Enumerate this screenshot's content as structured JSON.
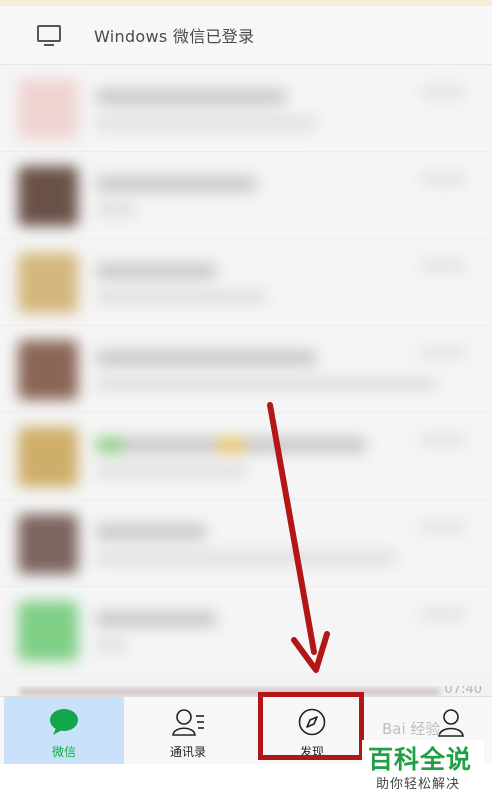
{
  "windows_login": {
    "icon": "monitor-icon",
    "text": "Windows 微信已登录"
  },
  "chat_list": {
    "rows": [
      {
        "avatar_color": "#e9d1cf"
      },
      {
        "avatar_color": "#6a5148"
      },
      {
        "avatar_color": "#d4b77c"
      },
      {
        "avatar_color": "#8b6657"
      },
      {
        "avatar_color": "#cfae6a"
      },
      {
        "avatar_color": "#7c6660"
      },
      {
        "avatar_color": "#7fcf86"
      }
    ],
    "last_visible_time": "07:40"
  },
  "tab_bar": {
    "tabs": [
      {
        "label": "微信",
        "icon": "chat-bubble-icon",
        "active": true
      },
      {
        "label": "通讯录",
        "icon": "contacts-icon",
        "active": false
      },
      {
        "label": "发现",
        "icon": "compass-icon",
        "active": false
      },
      {
        "label": "",
        "icon": "person-icon",
        "active": false
      }
    ],
    "active_color": "#12a74a",
    "active_bg": "#c9e2fa"
  },
  "annotation": {
    "color": "#b21616",
    "target": "发现"
  },
  "watermark": {
    "title": "百科全说",
    "subtitle": "助你轻松解决",
    "baidu": "Bai 经验"
  }
}
